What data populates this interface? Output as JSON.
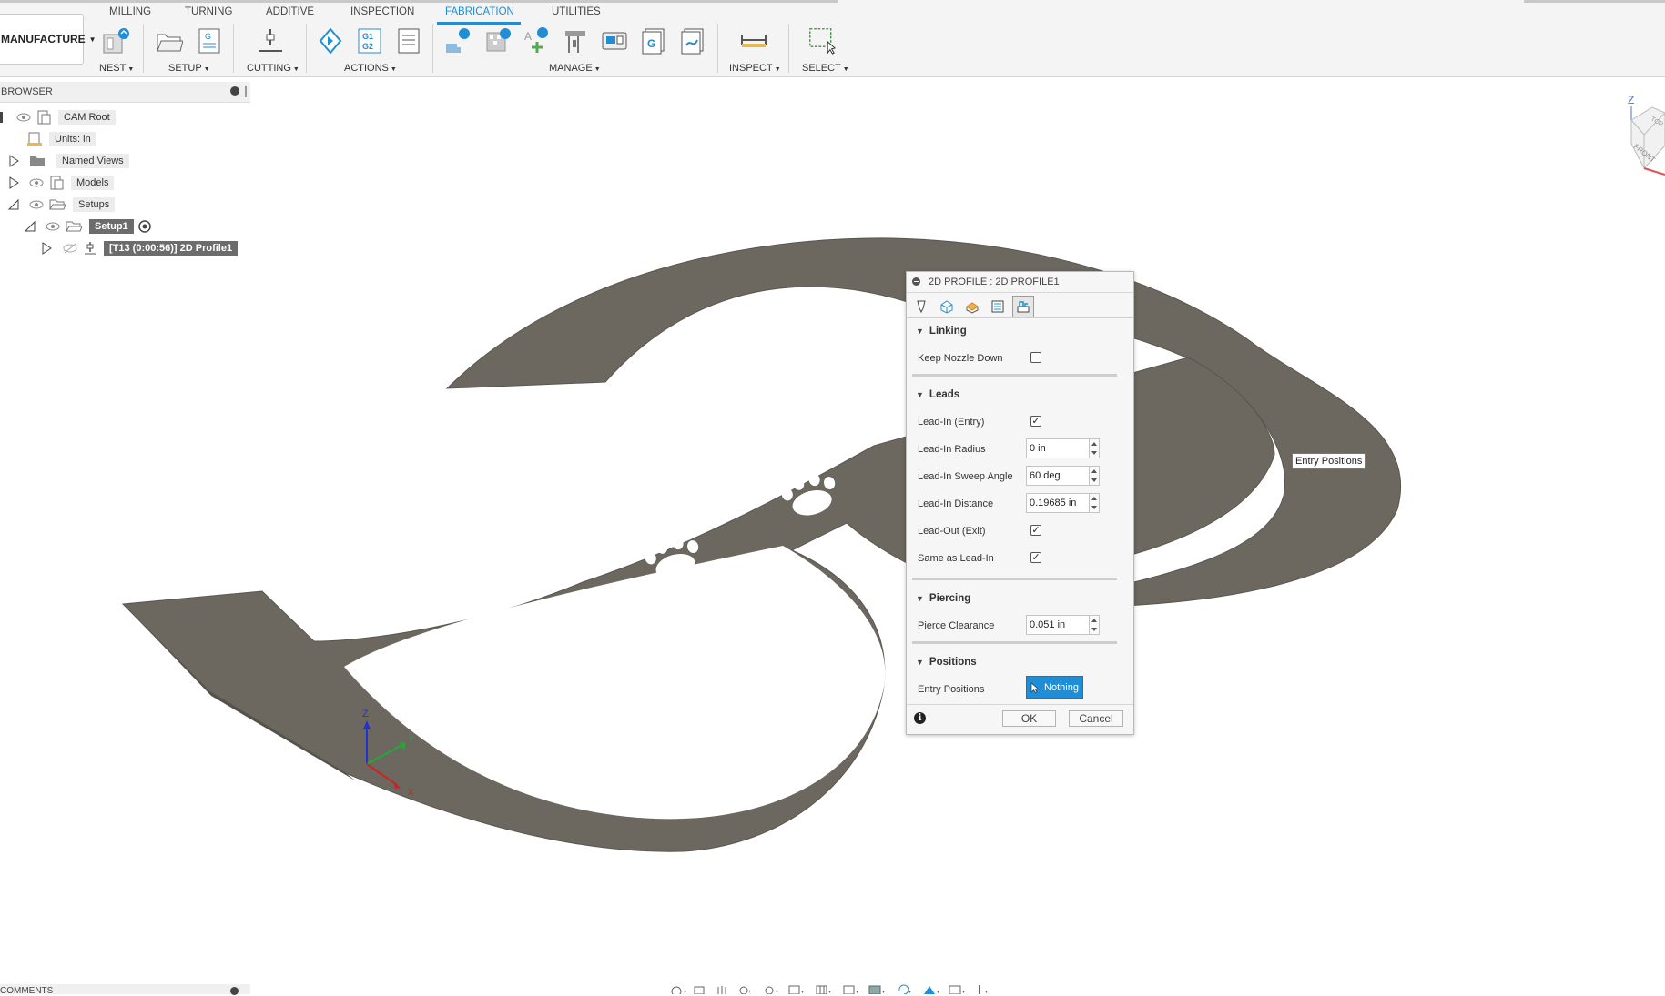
{
  "workspace": {
    "label": "MANUFACTURE"
  },
  "tabs": [
    {
      "label": "MILLING"
    },
    {
      "label": "TURNING"
    },
    {
      "label": "ADDITIVE"
    },
    {
      "label": "INSPECTION"
    },
    {
      "label": "FABRICATION",
      "active": true
    },
    {
      "label": "UTILITIES"
    }
  ],
  "groups": {
    "nest": "NEST",
    "setup": "SETUP",
    "cutting": "CUTTING",
    "actions": "ACTIONS",
    "manage": "MANAGE",
    "inspect": "INSPECT",
    "select": "SELECT"
  },
  "actions_icon_text": {
    "g1g2": "G1\nG2"
  },
  "browser": {
    "title": "BROWSER",
    "items": [
      {
        "label": "CAM Root"
      },
      {
        "label": "Units: in"
      },
      {
        "label": "Named Views"
      },
      {
        "label": "Models"
      },
      {
        "label": "Setups"
      },
      {
        "label": "Setup1"
      },
      {
        "label": "[T13 (0:00:56)] 2D Profile1"
      }
    ]
  },
  "dialog": {
    "title": "2D PROFILE : 2D PROFILE1",
    "sections": {
      "linking": "Linking",
      "leads": "Leads",
      "piercing": "Piercing",
      "positions": "Positions"
    },
    "fields": {
      "keep_nozzle_down": {
        "label": "Keep Nozzle Down",
        "checked": false
      },
      "lead_in": {
        "label": "Lead-In (Entry)",
        "checked": true
      },
      "lead_in_radius": {
        "label": "Lead-In Radius",
        "value": "0 in"
      },
      "lead_in_sweep": {
        "label": "Lead-In Sweep Angle",
        "value": "60 deg"
      },
      "lead_in_distance": {
        "label": "Lead-In Distance",
        "value": "0.19685 in"
      },
      "lead_out": {
        "label": "Lead-Out (Exit)",
        "checked": true
      },
      "same_as_lead_in": {
        "label": "Same as Lead-In",
        "checked": true
      },
      "pierce_clearance": {
        "label": "Pierce Clearance",
        "value": "0.051 in"
      },
      "entry_positions": {
        "label": "Entry Positions",
        "button": "Nothing"
      }
    },
    "ok": "OK",
    "cancel": "Cancel"
  },
  "tooltip": "Entry Positions",
  "viewcube": {
    "top_label": "Z",
    "face": "FRONT",
    "face2": "TOP"
  },
  "axes": {
    "z": "Z",
    "y": "Y",
    "x": "X"
  },
  "comments": {
    "title": "COMMENTS"
  },
  "colors": {
    "accent": "#1f8ed6",
    "part": "#6c6860",
    "part_edge": "#5a564f"
  }
}
